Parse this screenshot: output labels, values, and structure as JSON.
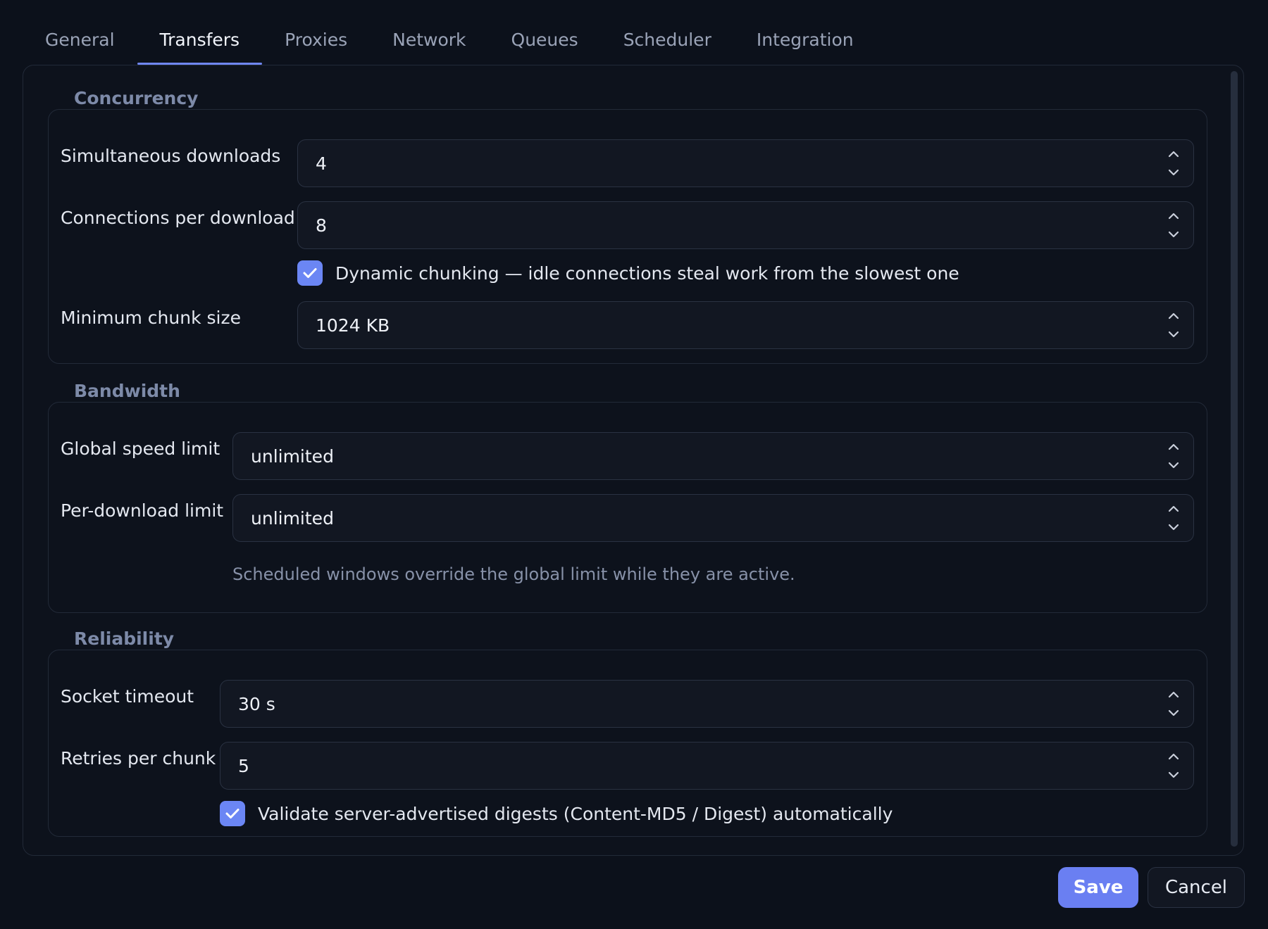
{
  "tabs": [
    {
      "label": "General",
      "active": false
    },
    {
      "label": "Transfers",
      "active": true
    },
    {
      "label": "Proxies",
      "active": false
    },
    {
      "label": "Network",
      "active": false
    },
    {
      "label": "Queues",
      "active": false
    },
    {
      "label": "Scheduler",
      "active": false
    },
    {
      "label": "Integration",
      "active": false
    }
  ],
  "concurrency": {
    "title": "Concurrency",
    "simultaneous_label": "Simultaneous downloads",
    "simultaneous_value": "4",
    "connections_label": "Connections per download",
    "connections_value": "8",
    "dynamic_chunking_label": "Dynamic chunking — idle connections steal work from the slowest one",
    "dynamic_chunking_checked": true,
    "min_chunk_label": "Minimum chunk size",
    "min_chunk_value": "1024 KB"
  },
  "bandwidth": {
    "title": "Bandwidth",
    "global_label": "Global speed limit",
    "global_value": "unlimited",
    "per_download_label": "Per-download limit",
    "per_download_value": "unlimited",
    "hint": "Scheduled windows override the global limit while they are active."
  },
  "reliability": {
    "title": "Reliability",
    "timeout_label": "Socket timeout",
    "timeout_value": "30 s",
    "retries_label": "Retries per chunk",
    "retries_value": "5",
    "validate_label": "Validate server-advertised digests (Content-MD5 / Digest) automatically",
    "validate_checked": true
  },
  "buttons": {
    "save": "Save",
    "cancel": "Cancel"
  },
  "colors": {
    "accent": "#6a7ff2",
    "background": "#0c111b",
    "group_title": "#7d8aa8"
  },
  "icons": {
    "spin_up": "chevron-up-icon",
    "spin_down": "chevron-down-icon",
    "check": "checkmark-icon"
  }
}
